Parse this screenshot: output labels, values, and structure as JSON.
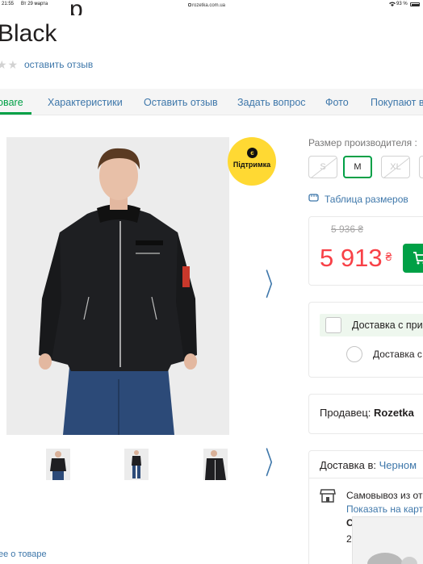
{
  "status_bar": {
    "time": "21:55",
    "date": "Вт 29 марта",
    "url": "rozetka.com.ua",
    "wifi_icon": "wifi-icon",
    "battery": "93 %"
  },
  "product": {
    "title_line2": "Black",
    "review_link": "оставить отзыв"
  },
  "tabs": [
    {
      "label": "овare"
    },
    {
      "label": "Характеристики"
    },
    {
      "label": "Оставить отзыв"
    },
    {
      "label": "Задать вопрос"
    },
    {
      "label": "Фото"
    },
    {
      "label": "Покупают в"
    }
  ],
  "gallery": {
    "support_badge": "Підтримка",
    "support_icon": "є",
    "about_link": "ее о товаре"
  },
  "sizes": {
    "label": "Размер производителя :",
    "options": [
      {
        "label": "S",
        "available": false
      },
      {
        "label": "M",
        "available": true,
        "selected": true
      },
      {
        "label": "XL",
        "available": false
      }
    ],
    "size_table_link": "Таблица размеров"
  },
  "price": {
    "old": "5 936 ₴",
    "current": "5 913",
    "currency": "₴"
  },
  "delivery_options": {
    "option1": "Доставка с при",
    "option2": "Доставка с"
  },
  "seller": {
    "label": "Продавец:",
    "name": "Rozetka"
  },
  "delivery": {
    "label": "Доставка в:",
    "city": "Черном",
    "pickup": "Самовывоз из от",
    "map_link": "Показать на карт",
    "cut_line1": "С",
    "cut_line2": "2"
  },
  "colors": {
    "accent_green": "#00a046",
    "link_blue": "#3e77aa",
    "price_red": "#f84147",
    "badge_yellow": "#ffd933"
  }
}
